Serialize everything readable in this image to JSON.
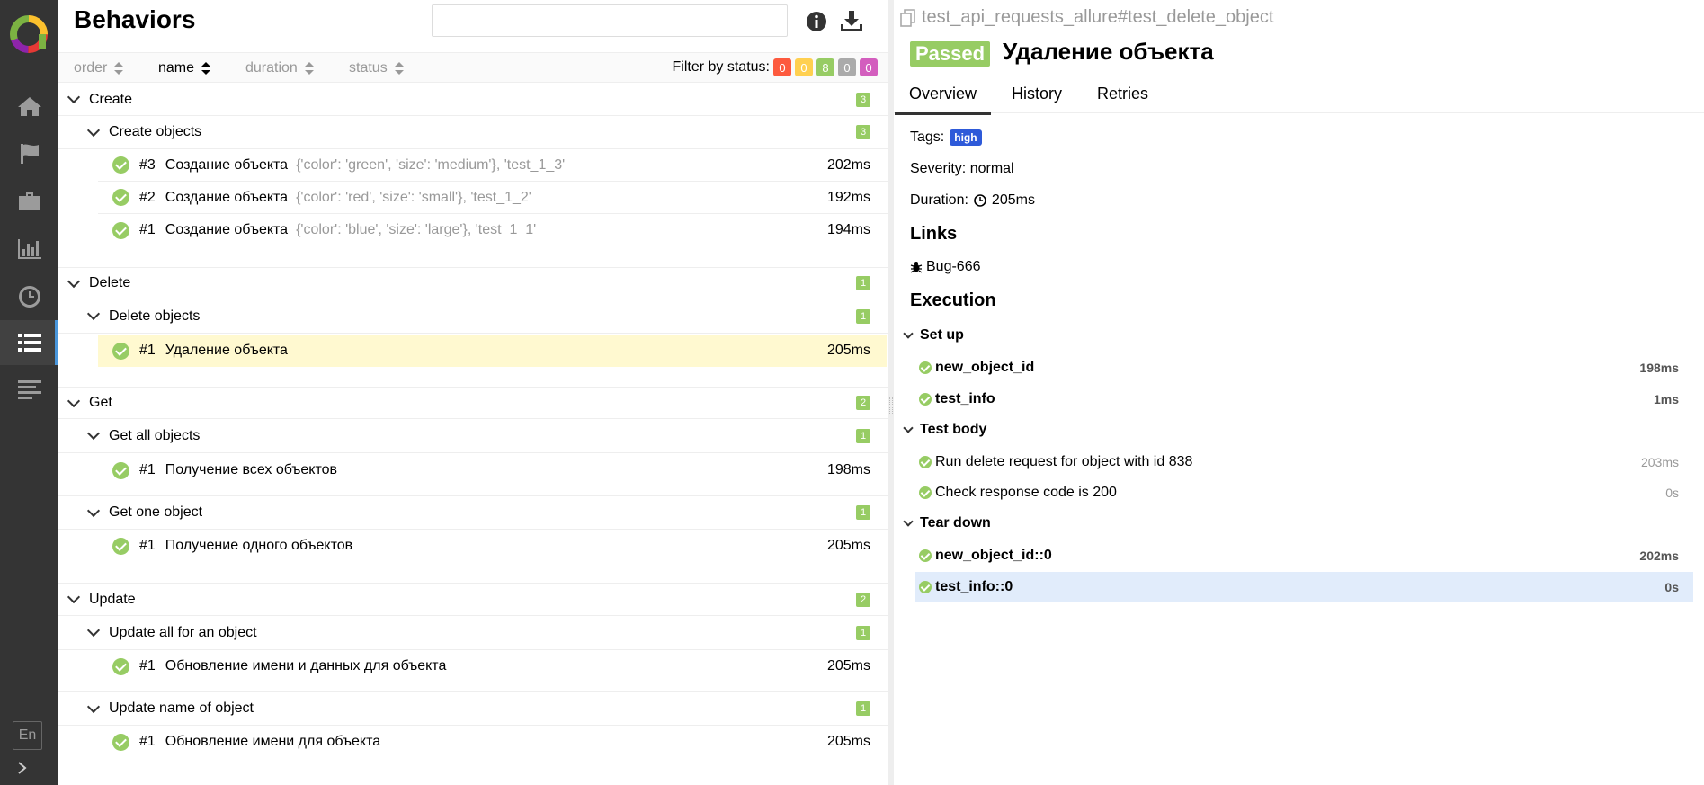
{
  "left": {
    "title": "Behaviors",
    "search": {
      "placeholder": ""
    },
    "sort": {
      "order": "order",
      "name": "name",
      "duration": "duration",
      "status": "status"
    },
    "filter": {
      "label": "Filter by status:",
      "counts": [
        "0",
        "0",
        "8",
        "0",
        "0"
      ],
      "colors": [
        "#fd5a3e",
        "#ffd050",
        "#97cc64",
        "#aaaaaa",
        "#d35ebe"
      ]
    },
    "features": [
      {
        "name": "Create",
        "count": "3",
        "stories": [
          {
            "name": "Create objects",
            "count": "3",
            "tests": [
              {
                "num": "#3",
                "name": "Создание объекта",
                "params": "{'color': 'green', 'size': 'medium'}, 'test_1_3'",
                "duration": "202ms"
              },
              {
                "num": "#2",
                "name": "Создание объекта",
                "params": "{'color': 'red', 'size': 'small'}, 'test_1_2'",
                "duration": "192ms"
              },
              {
                "num": "#1",
                "name": "Создание объекта",
                "params": "{'color': 'blue', 'size': 'large'}, 'test_1_1'",
                "duration": "194ms"
              }
            ]
          }
        ]
      },
      {
        "name": "Delete",
        "count": "1",
        "stories": [
          {
            "name": "Delete objects",
            "count": "1",
            "tests": [
              {
                "num": "#1",
                "name": "Удаление объекта",
                "params": "",
                "duration": "205ms"
              }
            ]
          }
        ]
      },
      {
        "name": "Get",
        "count": "2",
        "stories": [
          {
            "name": "Get all objects",
            "count": "1",
            "tests": [
              {
                "num": "#1",
                "name": "Получение всех объектов",
                "params": "",
                "duration": "198ms"
              }
            ]
          },
          {
            "name": "Get one object",
            "count": "1",
            "tests": [
              {
                "num": "#1",
                "name": "Получение одного объектов",
                "params": "",
                "duration": "205ms"
              }
            ]
          }
        ]
      },
      {
        "name": "Update",
        "count": "2",
        "stories": [
          {
            "name": "Update all for an object",
            "count": "1",
            "tests": [
              {
                "num": "#1",
                "name": "Обновление имени и данных для объекта",
                "params": "",
                "duration": "205ms"
              }
            ]
          },
          {
            "name": "Update name of object",
            "count": "1",
            "tests": [
              {
                "num": "#1",
                "name": "Обновление имени для объекта",
                "params": "",
                "duration": "205ms"
              }
            ]
          }
        ]
      }
    ]
  },
  "sidebar": {
    "lang": "En"
  },
  "right": {
    "path": "test_api_requests_allure#test_delete_object",
    "status": "Passed",
    "title": "Удаление объекта",
    "tabs": [
      "Overview",
      "History",
      "Retries"
    ],
    "tags_label": "Tags:",
    "tag": "high",
    "severity": "Severity: normal",
    "duration_label": "Duration:",
    "duration": "205ms",
    "links_heading": "Links",
    "link": "Bug-666",
    "execution_heading": "Execution",
    "setup": {
      "label": "Set up",
      "steps": [
        {
          "name": "new_object_id",
          "duration": "198ms"
        },
        {
          "name": "test_info",
          "duration": "1ms"
        }
      ]
    },
    "body": {
      "label": "Test body",
      "steps": [
        {
          "name": "Run delete request for object with id 838",
          "duration": "203ms"
        },
        {
          "name": "Check response code is 200",
          "duration": "0s"
        }
      ]
    },
    "teardown": {
      "label": "Tear down",
      "steps": [
        {
          "name": "new_object_id::0",
          "duration": "202ms"
        },
        {
          "name": "test_info::0",
          "duration": "0s"
        }
      ]
    }
  }
}
